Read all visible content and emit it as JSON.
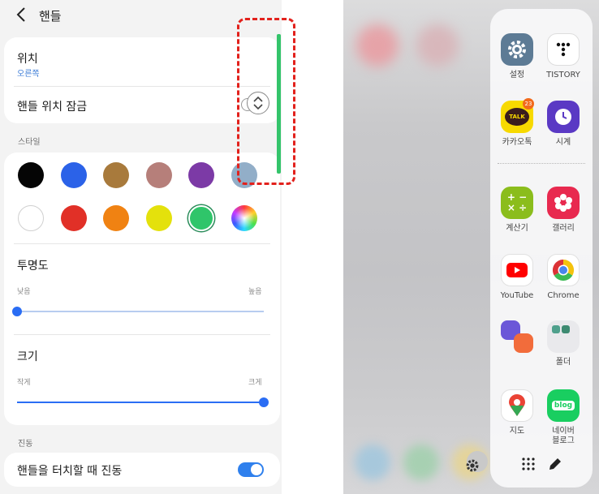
{
  "settings": {
    "header_title": "핸들",
    "position": {
      "title": "위치",
      "value": "오른쪽"
    },
    "lock": {
      "title": "핸들 위치 잠금"
    },
    "style_label": "스타일",
    "swatches": [
      {
        "name": "black",
        "color": "#050505"
      },
      {
        "name": "blue",
        "color": "#2b62e8"
      },
      {
        "name": "brown",
        "color": "#a87a3c"
      },
      {
        "name": "rose",
        "color": "#b67f7a"
      },
      {
        "name": "purple",
        "color": "#7c3aa6"
      },
      {
        "name": "gray-blue",
        "color": "#92aec8"
      },
      {
        "name": "white",
        "color": "#ffffff"
      },
      {
        "name": "red",
        "color": "#e13027"
      },
      {
        "name": "orange",
        "color": "#f08212"
      },
      {
        "name": "yellow",
        "color": "#e4e10c"
      },
      {
        "name": "green",
        "color": "#2fc56a"
      },
      {
        "name": "custom",
        "color": "conic"
      }
    ],
    "selected_swatch": "green",
    "transparency": {
      "title": "투명도",
      "low": "낮음",
      "high": "높음",
      "value": 0.0
    },
    "size": {
      "title": "크기",
      "small": "작게",
      "large": "크게",
      "value": 1.0
    },
    "vibration_label": "진동",
    "vibration": {
      "title": "핸들을 터치할 때 진동",
      "on": true
    },
    "handle_color": "#34c46b",
    "accent": "#2a6df4"
  },
  "edge_panel": {
    "apps": [
      {
        "id": "settings",
        "label": "설정"
      },
      {
        "id": "tistory",
        "label": "TISTORY"
      },
      {
        "id": "kakaotalk",
        "label": "카카오톡",
        "badge": "23",
        "icon_text": "TALK"
      },
      {
        "id": "clock",
        "label": "시계"
      },
      {
        "id": "calculator",
        "label": "계산기"
      },
      {
        "id": "gallery",
        "label": "갤러리"
      },
      {
        "id": "youtube",
        "label": "YouTube"
      },
      {
        "id": "chrome",
        "label": "Chrome"
      },
      {
        "id": "pair",
        "label": ""
      },
      {
        "id": "folder",
        "label": "폴더"
      },
      {
        "id": "maps",
        "label": "지도"
      },
      {
        "id": "naver-blog",
        "label": "네이버\n블로그",
        "icon_text": "blog"
      }
    ]
  }
}
